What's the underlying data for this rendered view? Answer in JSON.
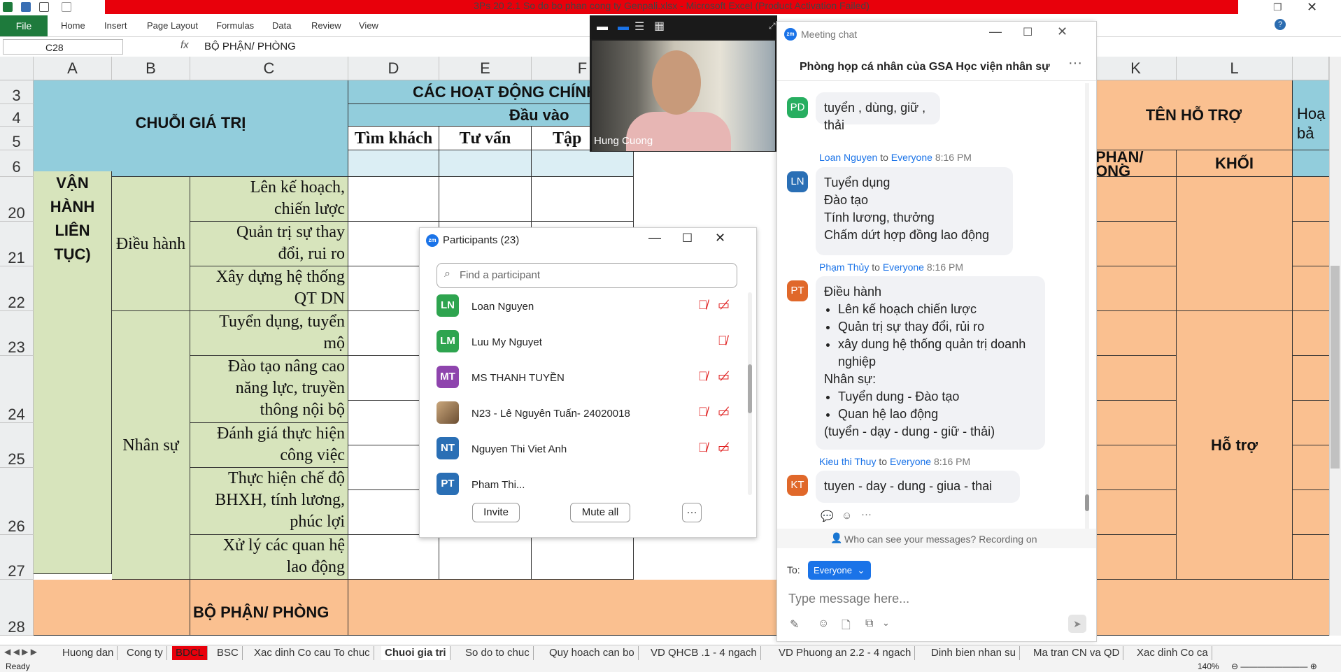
{
  "window": {
    "title": "3Ps 20 2.1 So do bo phan cong ty Genpali.xlsx - Microsoft Excel (Product Activation Failed)"
  },
  "ribbon": {
    "tabs": [
      "File",
      "Home",
      "Insert",
      "Page Layout",
      "Formulas",
      "Data",
      "Review",
      "View"
    ]
  },
  "formula_bar": {
    "name_box": "C28",
    "fx": "fx",
    "value": "BỘ PHẬN/ PHÒNG"
  },
  "grid": {
    "columns": [
      "A",
      "B",
      "C",
      "D",
      "E",
      "F",
      "K",
      "L"
    ],
    "rows": [
      "3",
      "4",
      "5",
      "6",
      "20",
      "21",
      "22",
      "23",
      "24",
      "25",
      "26",
      "27",
      "28"
    ],
    "cells": {
      "hoat_dong": "CÁC HOẠT ĐỘNG CHÍNH",
      "dau_vao": "Đầu vào",
      "chuoi_gia_tri": "CHUỖI GIÁ TRỊ",
      "tim_khach": "Tìm khách",
      "tu_van": "Tư vấn",
      "tap": "Tập",
      "ten_ho_tro": "TÊN HỖ TRỢ",
      "hoa_b": "Hoạ\nbả",
      "phan_ong": "PHẬN/\nONG",
      "khoi": "KHỐI",
      "van_hanh": "VẬN\nHÀNH\nLIÊN\nTỤC)",
      "dieu_hanh": "Điều hành",
      "nhan_su": "Nhân sự",
      "r20": "Lên kế hoạch,\nchiến lược",
      "r21": "Quản trị sự thay\nđổi, rui ro",
      "r22": "Xây dựng hệ thống\nQT DN",
      "r23": "Tuyển dụng, tuyển\nmộ",
      "r24": "Đào tạo nâng cao\nnăng lực, truyền\nthông nội bộ",
      "r25": "Đánh giá thực hiện\ncông việc",
      "r26": "Thực hiện chế độ\nBHXH, tính lương,\nphúc lợi",
      "r27": "Xử lý các quan hệ\nlao động",
      "r28": "BỘ PHẬN/ PHÒNG",
      "ho_tro": "Hỗ trợ"
    }
  },
  "sheet_tabs": [
    "Huong dan",
    "Cong ty",
    "BDCL",
    "BSC",
    "Xac dinh Co cau To chuc",
    "Chuoi gia tri",
    "So do to chuc",
    "Quy hoach can bo",
    "VD QHCB .1 - 4 ngach",
    "VD Phuong an 2.2 - 4 ngach",
    "Dinh bien nhan su",
    "Ma tran CN va QD",
    "Xac dinh Co ca"
  ],
  "active_sheet": "Chuoi gia tri",
  "status": {
    "ready": "Ready",
    "zoom": "140%"
  },
  "video": {
    "name": "Hung Cuong"
  },
  "participants": {
    "title": "Participants (23)",
    "search_placeholder": "Find a participant",
    "people": [
      {
        "initials": "LN",
        "name": "Loan Nguyen",
        "color": "#2ea44f",
        "cam": true
      },
      {
        "initials": "LM",
        "name": "Luu My Nguyet",
        "color": "#2ea44f",
        "cam": false
      },
      {
        "initials": "MT",
        "name": "MS THANH TUYỀN",
        "color": "#8e44ad",
        "cam": true
      },
      {
        "initials": "",
        "name": "N23 - Lê Nguyên Tuấn- 24020018",
        "color": "#9a7b5a",
        "cam": true
      },
      {
        "initials": "NT",
        "name": "Nguyen Thi Viet Anh",
        "color": "#2a6fb5",
        "cam": true
      },
      {
        "initials": "PT",
        "name": "Pham Thi...",
        "color": "#2a6fb5",
        "cam": true
      }
    ],
    "invite": "Invite",
    "mute_all": "Mute all",
    "more": "···"
  },
  "chat": {
    "window_title": "Meeting chat",
    "room_title": "Phòng họp cá nhân của GSA Học viện nhân sự",
    "msg0": {
      "initials": "PD",
      "color": "#27ae60",
      "text": "tuyển , dùng, giữ , thải"
    },
    "msg1": {
      "initials": "LN",
      "color": "#2a6fb5",
      "sender": "Loan Nguyen",
      "to": "to",
      "everyone": "Everyone",
      "time": "8:16 PM",
      "lines": [
        "Tuyển dụng",
        "Đào tạo",
        "Tính lương, thưởng",
        "Chấm dứt hợp đồng lao động"
      ]
    },
    "msg2": {
      "initials": "PT",
      "color": "#e0682a",
      "sender": "Phạm Thủy",
      "to": "to",
      "everyone": "Everyone",
      "time": "8:16 PM",
      "h1": "Điều hành",
      "l1": [
        "Lên kế hoạch chiến lược",
        "Quản trị sự thay đổi, rủi ro",
        "xây dung hệ thống quản trị doanh nghiệp"
      ],
      "h2": "Nhân sự:",
      "l2": [
        "Tuyển dung - Đào tạo",
        "Quan hệ lao động"
      ],
      "tail": "(tuyển - dạy - dung - giữ - thải)"
    },
    "msg3": {
      "initials": "KT",
      "color": "#e0682a",
      "sender": "Kieu thi Thuy",
      "to": "to",
      "everyone": "Everyone",
      "time": "8:16 PM",
      "text": "tuyen - day - dung - giua - thai"
    },
    "privacy": "Who can see your messages? Recording on",
    "to_label": "To:",
    "to_value": "Everyone",
    "input_placeholder": "Type message here..."
  }
}
